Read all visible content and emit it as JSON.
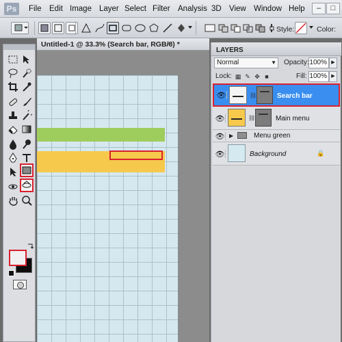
{
  "app": {
    "logo": "Ps"
  },
  "menu": [
    "File",
    "Edit",
    "Image",
    "Layer",
    "Select",
    "Filter",
    "Analysis",
    "3D",
    "View",
    "Window",
    "Help"
  ],
  "window_controls": {
    "minimize": "–",
    "restore": "□",
    "close": "✕"
  },
  "options_bar": {
    "style_label": "Style:",
    "color_label": "Color:"
  },
  "document": {
    "tab_title": "Untitled-1 @ 33.3% (Search bar, RGB/8) *",
    "close_glyph": "×",
    "colors": {
      "green_band": "#9fcd5d",
      "yellow_band": "#f6c94d",
      "grid_bg": "#d6e8ef"
    }
  },
  "tools": [
    "marquee-icon",
    "move-icon",
    "lasso-icon",
    "quick-select-icon",
    "crop-icon",
    "eyedropper-icon",
    "healing-icon",
    "brush-icon",
    "stamp-icon",
    "history-brush-icon",
    "eraser-icon",
    "gradient-icon",
    "blur-icon",
    "dodge-icon",
    "pen-icon",
    "type-icon",
    "path-select-icon",
    "rectangle-icon",
    "3d-rotate-icon",
    "3d-orbit-icon",
    "hand-icon",
    "zoom-icon"
  ],
  "layers_panel": {
    "title": "LAYERS",
    "blend_mode": "Normal",
    "opacity_label": "Opacity:",
    "opacity_value": "100%",
    "lock_label": "Lock:",
    "fill_label": "Fill:",
    "fill_value": "100%",
    "layers": [
      {
        "name": "Search bar",
        "selected": true
      },
      {
        "name": "Main menu",
        "selected": false
      },
      {
        "name": "Menu green",
        "selected": false
      },
      {
        "name": "Background",
        "selected": false
      }
    ],
    "accent_color": "#3a8ef0",
    "highlight_color": "#d9202e"
  }
}
